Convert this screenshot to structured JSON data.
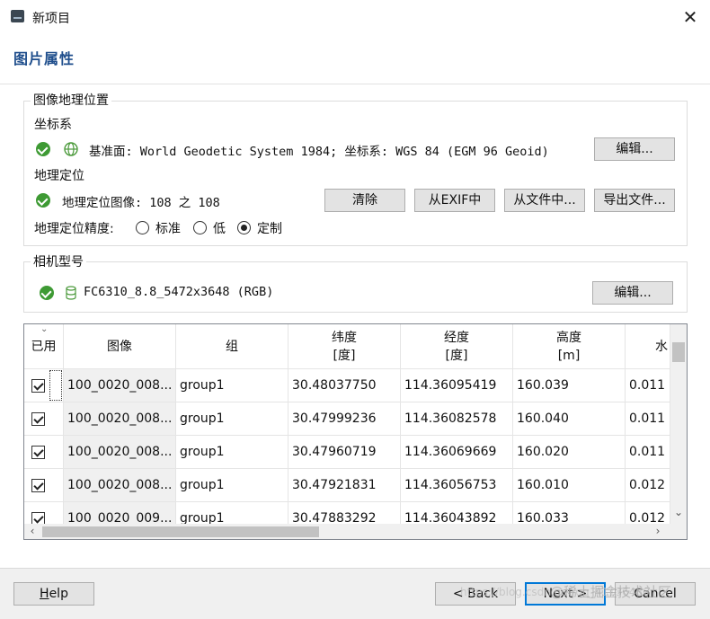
{
  "window": {
    "title": "新项目",
    "close_glyph": "✕"
  },
  "page": {
    "title": "图片属性"
  },
  "geo_group": {
    "legend": "图像地理位置",
    "crs_label": "坐标系",
    "crs_text": "基准面: World Geodetic System 1984; 坐标系: WGS 84 (EGM 96 Geoid)",
    "crs_edit": "编辑...",
    "geoloc_label": "地理定位",
    "geoloc_text": "地理定位图像: 108 之 108",
    "clear": "清除",
    "from_exif": "从EXIF中",
    "from_file": "从文件中...",
    "export_file": "导出文件...",
    "accuracy_label": "地理定位精度:",
    "accuracy_options": [
      "标准",
      "低",
      "定制"
    ],
    "accuracy_selected": "定制"
  },
  "camera_group": {
    "legend": "相机型号",
    "model": "FC6310_8.8_5472x3648 (RGB)",
    "edit": "编辑..."
  },
  "table": {
    "columns": [
      {
        "line1": "已用",
        "line2": ""
      },
      {
        "line1": "图像",
        "line2": ""
      },
      {
        "line1": "组",
        "line2": ""
      },
      {
        "line1": "纬度",
        "line2": "[度]"
      },
      {
        "line1": "经度",
        "line2": "[度]"
      },
      {
        "line1": "高度",
        "line2": "[m]"
      },
      {
        "line1": "水",
        "line2": ""
      }
    ],
    "rows": [
      {
        "used": true,
        "image": "100_0020_008...",
        "group": "group1",
        "lat": "30.48037750",
        "lon": "114.36095419",
        "alt": "160.039",
        "h": "0.011"
      },
      {
        "used": true,
        "image": "100_0020_008...",
        "group": "group1",
        "lat": "30.47999236",
        "lon": "114.36082578",
        "alt": "160.040",
        "h": "0.011"
      },
      {
        "used": true,
        "image": "100_0020_008...",
        "group": "group1",
        "lat": "30.47960719",
        "lon": "114.36069669",
        "alt": "160.020",
        "h": "0.011"
      },
      {
        "used": true,
        "image": "100_0020_008...",
        "group": "group1",
        "lat": "30.47921831",
        "lon": "114.36056753",
        "alt": "160.010",
        "h": "0.012"
      },
      {
        "used": true,
        "image": "100_0020_009...",
        "group": "group1",
        "lat": "30.47883292",
        "lon": "114.36043892",
        "alt": "160.033",
        "h": "0.012"
      }
    ]
  },
  "footer": {
    "help": "Help",
    "back": "< Back",
    "next": "Next >",
    "cancel": "Cancel"
  },
  "watermark": {
    "url": "https://blog.csdn.net/qq_41136486",
    "brand": "@稀土掘金技术社区"
  },
  "icons": [
    "app-icon",
    "close-icon",
    "check-circle-icon",
    "globe-icon",
    "database-icon",
    "sort-chevron-icon"
  ],
  "colors": {
    "title_blue": "#1f4e8c",
    "ok_green": "#3e9a34",
    "primary_border": "#0078d7"
  }
}
